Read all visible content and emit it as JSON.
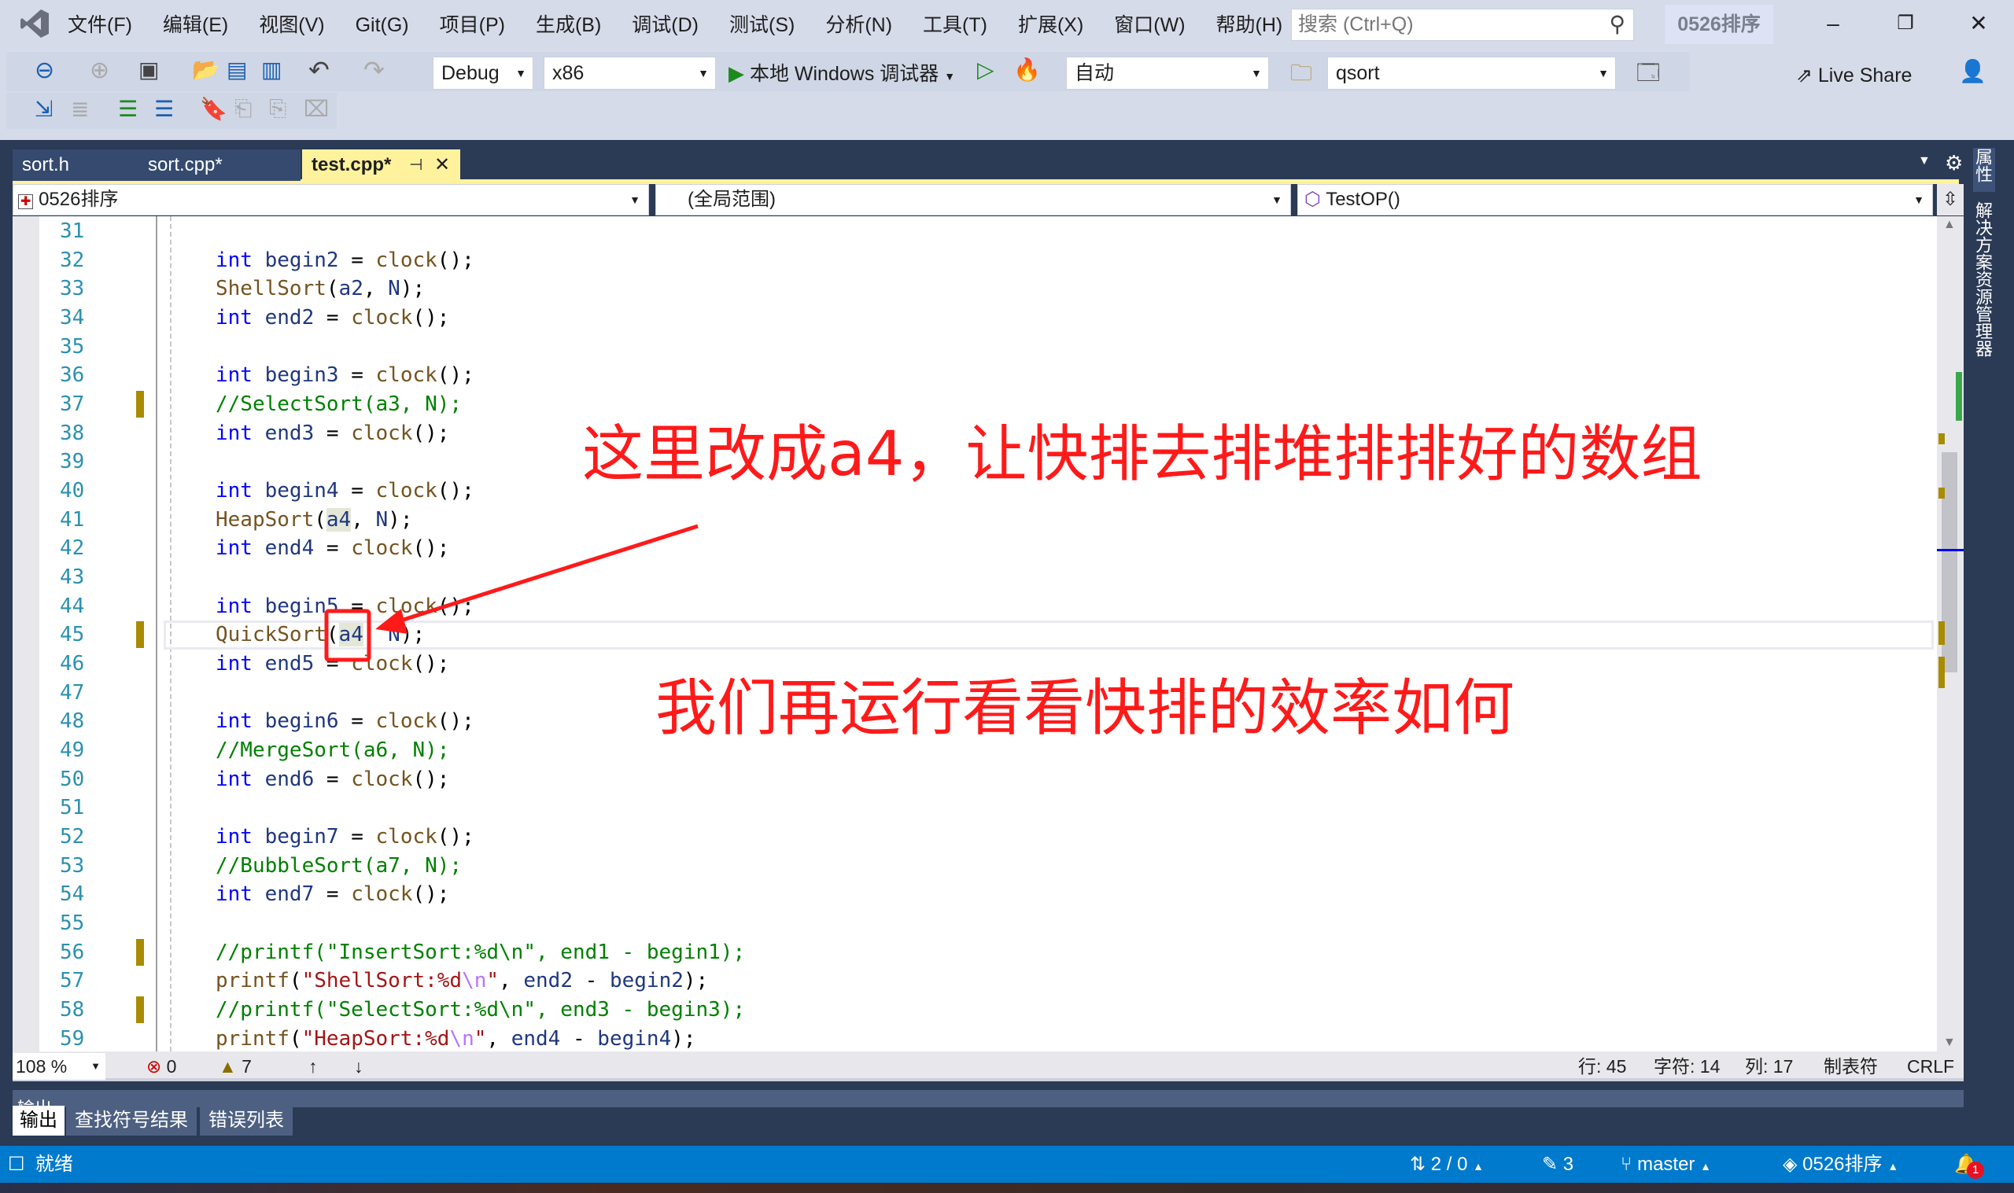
{
  "title_bar": {
    "menu": [
      "文件(F)",
      "编辑(E)",
      "视图(V)",
      "Git(G)",
      "项目(P)",
      "生成(B)",
      "调试(D)",
      "测试(S)",
      "分析(N)",
      "工具(T)",
      "扩展(X)",
      "窗口(W)",
      "帮助(H)"
    ],
    "search_placeholder": "搜索 (Ctrl+Q)",
    "solution_name": "0526排序"
  },
  "toolbar": {
    "config": "Debug",
    "platform": "x86",
    "debugger": "本地 Windows 调试器",
    "auto": "自动",
    "find": "qsort",
    "live_share": "Live Share"
  },
  "tabs": [
    {
      "label": "sort.h",
      "active": false
    },
    {
      "label": "sort.cpp*",
      "active": false
    },
    {
      "label": "test.cpp*",
      "active": true
    }
  ],
  "nav": {
    "project": "0526排序",
    "scope": "(全局范围)",
    "member": "TestOP()"
  },
  "code": {
    "lines": [
      {
        "n": "31",
        "t": []
      },
      {
        "n": "32",
        "t": [
          [
            "k",
            "int"
          ],
          [
            "v",
            " begin2"
          ],
          [
            "p",
            " = "
          ],
          [
            "f",
            "clock"
          ],
          [
            "p",
            "();"
          ]
        ]
      },
      {
        "n": "33",
        "t": [
          [
            "f",
            "ShellSort"
          ],
          [
            "p",
            "("
          ],
          [
            "v",
            "a2"
          ],
          [
            "p",
            ", "
          ],
          [
            "v",
            "N"
          ],
          [
            "p",
            ");"
          ]
        ]
      },
      {
        "n": "34",
        "t": [
          [
            "k",
            "int"
          ],
          [
            "v",
            " end2"
          ],
          [
            "p",
            " = "
          ],
          [
            "f",
            "clock"
          ],
          [
            "p",
            "();"
          ]
        ]
      },
      {
        "n": "35",
        "t": []
      },
      {
        "n": "36",
        "t": [
          [
            "k",
            "int"
          ],
          [
            "v",
            " begin3"
          ],
          [
            "p",
            " = "
          ],
          [
            "f",
            "clock"
          ],
          [
            "p",
            "();"
          ]
        ]
      },
      {
        "n": "37",
        "m": true,
        "t": [
          [
            "c",
            "//SelectSort(a3, N);"
          ]
        ]
      },
      {
        "n": "38",
        "t": [
          [
            "k",
            "int"
          ],
          [
            "v",
            " end3"
          ],
          [
            "p",
            " = "
          ],
          [
            "f",
            "clock"
          ],
          [
            "p",
            "();"
          ]
        ]
      },
      {
        "n": "39",
        "t": []
      },
      {
        "n": "40",
        "t": [
          [
            "k",
            "int"
          ],
          [
            "v",
            " begin4"
          ],
          [
            "p",
            " = "
          ],
          [
            "f",
            "clock"
          ],
          [
            "p",
            "();"
          ]
        ]
      },
      {
        "n": "41",
        "t": [
          [
            "f",
            "HeapSort"
          ],
          [
            "p",
            "("
          ],
          [
            "h",
            "a4"
          ],
          [
            "p",
            ", "
          ],
          [
            "v",
            "N"
          ],
          [
            "p",
            ");"
          ]
        ]
      },
      {
        "n": "42",
        "t": [
          [
            "k",
            "int"
          ],
          [
            "v",
            " end4"
          ],
          [
            "p",
            " = "
          ],
          [
            "f",
            "clock"
          ],
          [
            "p",
            "();"
          ]
        ]
      },
      {
        "n": "43",
        "t": []
      },
      {
        "n": "44",
        "t": [
          [
            "k",
            "int"
          ],
          [
            "v",
            " begin5"
          ],
          [
            "p",
            " = "
          ],
          [
            "f",
            "clock"
          ],
          [
            "p",
            "();"
          ]
        ]
      },
      {
        "n": "45",
        "m": true,
        "cur": true,
        "t": [
          [
            "f",
            "QuickSort"
          ],
          [
            "p",
            "("
          ],
          [
            "h",
            "a4"
          ],
          [
            "p",
            ", "
          ],
          [
            "v",
            "N"
          ],
          [
            "p",
            ");"
          ]
        ]
      },
      {
        "n": "46",
        "t": [
          [
            "k",
            "int"
          ],
          [
            "v",
            " end5"
          ],
          [
            "p",
            " = "
          ],
          [
            "f",
            "clock"
          ],
          [
            "p",
            "();"
          ]
        ]
      },
      {
        "n": "47",
        "t": []
      },
      {
        "n": "48",
        "t": [
          [
            "k",
            "int"
          ],
          [
            "v",
            " begin6"
          ],
          [
            "p",
            " = "
          ],
          [
            "f",
            "clock"
          ],
          [
            "p",
            "();"
          ]
        ]
      },
      {
        "n": "49",
        "t": [
          [
            "c",
            "//MergeSort(a6, N);"
          ]
        ]
      },
      {
        "n": "50",
        "t": [
          [
            "k",
            "int"
          ],
          [
            "v",
            " end6"
          ],
          [
            "p",
            " = "
          ],
          [
            "f",
            "clock"
          ],
          [
            "p",
            "();"
          ]
        ]
      },
      {
        "n": "51",
        "t": []
      },
      {
        "n": "52",
        "t": [
          [
            "k",
            "int"
          ],
          [
            "v",
            " begin7"
          ],
          [
            "p",
            " = "
          ],
          [
            "f",
            "clock"
          ],
          [
            "p",
            "();"
          ]
        ]
      },
      {
        "n": "53",
        "t": [
          [
            "c",
            "//BubbleSort(a7, N);"
          ]
        ]
      },
      {
        "n": "54",
        "t": [
          [
            "k",
            "int"
          ],
          [
            "v",
            " end7"
          ],
          [
            "p",
            " = "
          ],
          [
            "f",
            "clock"
          ],
          [
            "p",
            "();"
          ]
        ]
      },
      {
        "n": "55",
        "t": []
      },
      {
        "n": "56",
        "m": true,
        "t": [
          [
            "c",
            "//printf(\"InsertSort:%d\\n\", end1 - begin1);"
          ]
        ]
      },
      {
        "n": "57",
        "t": [
          [
            "f",
            "printf"
          ],
          [
            "p",
            "("
          ],
          [
            "s",
            "\"ShellSort:%d"
          ],
          [
            "e",
            "\\n"
          ],
          [
            "s",
            "\""
          ],
          [
            "p",
            ", "
          ],
          [
            "v",
            "end2"
          ],
          [
            "p",
            " - "
          ],
          [
            "v",
            "begin2"
          ],
          [
            "p",
            ");"
          ]
        ]
      },
      {
        "n": "58",
        "m": true,
        "t": [
          [
            "c",
            "//printf(\"SelectSort:%d\\n\", end3 - begin3);"
          ]
        ]
      },
      {
        "n": "59",
        "t": [
          [
            "f",
            "printf"
          ],
          [
            "p",
            "("
          ],
          [
            "s",
            "\"HeapSort:%d"
          ],
          [
            "e",
            "\\n"
          ],
          [
            "s",
            "\""
          ],
          [
            "p",
            ", "
          ],
          [
            "v",
            "end4"
          ],
          [
            "p",
            " - "
          ],
          [
            "v",
            "begin4"
          ],
          [
            "p",
            ");"
          ]
        ]
      }
    ]
  },
  "annotations": {
    "note1": "这里改成a4，让快排去排堆排排好的数组",
    "note2": "我们再运行看看快排的效率如何",
    "color": "#ff1a1a"
  },
  "editor_status": {
    "zoom": "108 %",
    "errors": "0",
    "warnings": "7",
    "line": "行: 45",
    "char": "字符: 14",
    "col": "列: 17",
    "tabs": "制表符",
    "eol": "CRLF"
  },
  "output_panel": {
    "title": "输出",
    "tabs": [
      "输出",
      "查找符号结果",
      "错误列表"
    ]
  },
  "status_bar": {
    "ready": "就绪",
    "sync": "2 / 0",
    "edits": "3",
    "branch": "master",
    "repo": "0526排序",
    "notifications": "1",
    "color": "#007acc"
  },
  "side_tabs": [
    "属性",
    "解决方案资源管理器"
  ]
}
